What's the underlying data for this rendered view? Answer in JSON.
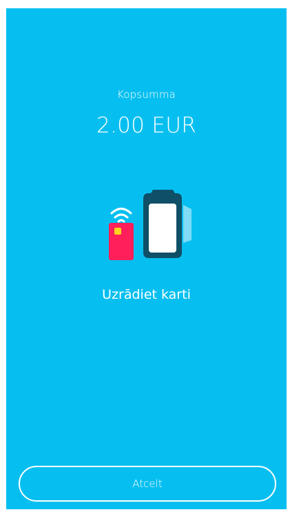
{
  "payment": {
    "total_label": "Kopsumma",
    "amount": "2.00 EUR",
    "instruction": "Uzrādiet karti"
  },
  "actions": {
    "cancel_label": "Atcelt"
  },
  "icons": {
    "illustration": "contactless-card-terminal-icon"
  },
  "colors": {
    "background": "#06bff0",
    "text": "#ffffff",
    "card": "#ff1f5a",
    "card_chip": "#ffd21f",
    "terminal": "#0f4f67",
    "terminal_screen": "#ffffff",
    "terminal_shadow": "#7fdbf6"
  }
}
